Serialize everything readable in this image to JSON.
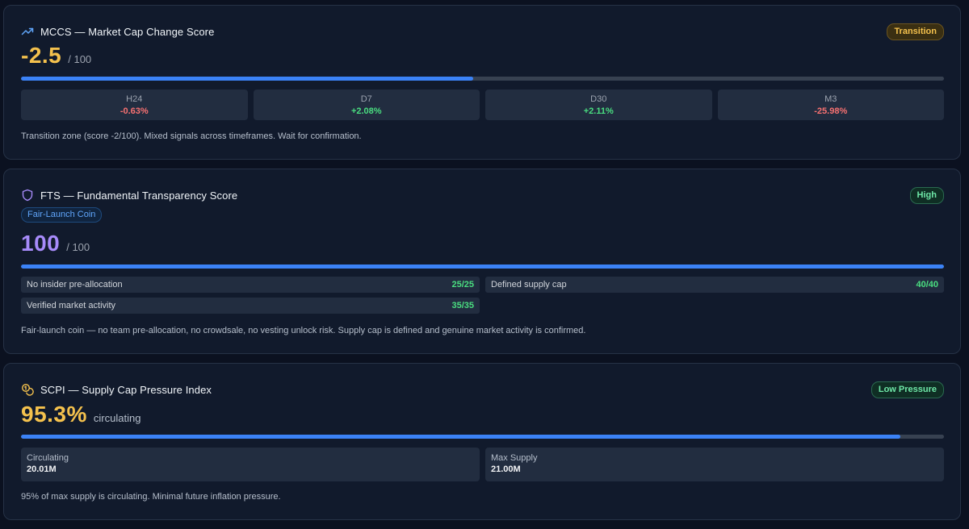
{
  "mccs": {
    "title": "MCCS — Market Cap Change Score",
    "badge": "Transition",
    "score": "-2.5",
    "score_suffix": "/ 100",
    "bar_fill_pct": 49,
    "timeframes": [
      {
        "label": "H24",
        "value": "-0.63%",
        "trend": "negative"
      },
      {
        "label": "D7",
        "value": "+2.08%",
        "trend": "positive"
      },
      {
        "label": "D30",
        "value": "+2.11%",
        "trend": "positive"
      },
      {
        "label": "M3",
        "value": "-25.98%",
        "trend": "negative"
      }
    ],
    "description": "Transition zone (score -2/100). Mixed signals across timeframes. Wait for confirmation.",
    "icon": "trending-up-icon"
  },
  "fts": {
    "title": "FTS — Fundamental Transparency Score",
    "badge": "High",
    "tag": "Fair-Launch Coin",
    "score": "100",
    "score_suffix": "/ 100",
    "bar_fill_pct": 100,
    "criteria": [
      {
        "label": "No insider pre-allocation",
        "score": "25/25"
      },
      {
        "label": "Defined supply cap",
        "score": "40/40"
      },
      {
        "label": "Verified market activity",
        "score": "35/35"
      }
    ],
    "description": "Fair-launch coin — no team pre-allocation, no crowdsale, no vesting unlock risk. Supply cap is defined and genuine market activity is confirmed.",
    "icon": "shield-icon"
  },
  "scpi": {
    "title": "SCPI — Supply Cap Pressure Index",
    "badge": "Low Pressure",
    "score": "95.3%",
    "score_suffix": "circulating",
    "bar_fill_pct": 95.3,
    "circulating_label": "Circulating",
    "circulating_value": "20.01M",
    "max_label": "Max Supply",
    "max_value": "21.00M",
    "description": "95% of max supply is circulating. Minimal future inflation pressure.",
    "icon": "coins-icon"
  },
  "colors": {
    "accent_blue": "#3b82f6",
    "score_amber": "#f4c14d",
    "score_purple": "#a78bfa",
    "positive": "#4ade80",
    "negative": "#f87171"
  }
}
